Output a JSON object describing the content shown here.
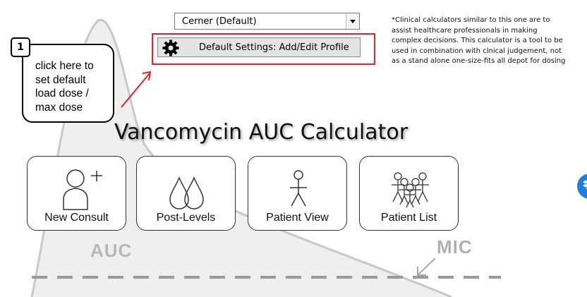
{
  "profile": {
    "selected": "Cerner (Default)"
  },
  "settings_button": {
    "label": "Default Settings: Add/Edit Profile"
  },
  "disclaimer": "*Clinical calculators similar to this one are to assist healthcare professionals in making complex decisions. This calculator is a tool to be used in combination with clnical judgement, not as a stand alone one-size-fits all depot for dosing",
  "callout": {
    "step": "1",
    "text": "click here to set default load dose / max dose"
  },
  "title": "Vancomycin AUC Calculator",
  "tiles": [
    {
      "label": "New Consult",
      "icon": "add-user-icon"
    },
    {
      "label": "Post-Levels",
      "icon": "drops-icon"
    },
    {
      "label": "Patient View",
      "icon": "stick-figure-icon"
    },
    {
      "label": "Patient List",
      "icon": "group-icon"
    }
  ],
  "background": {
    "auc_label": "AUC",
    "mic_label": "MIC"
  },
  "colors": {
    "highlight_frame": "#d9252b",
    "arrow": "#d9252b",
    "background_art": "#c8c8c8"
  }
}
